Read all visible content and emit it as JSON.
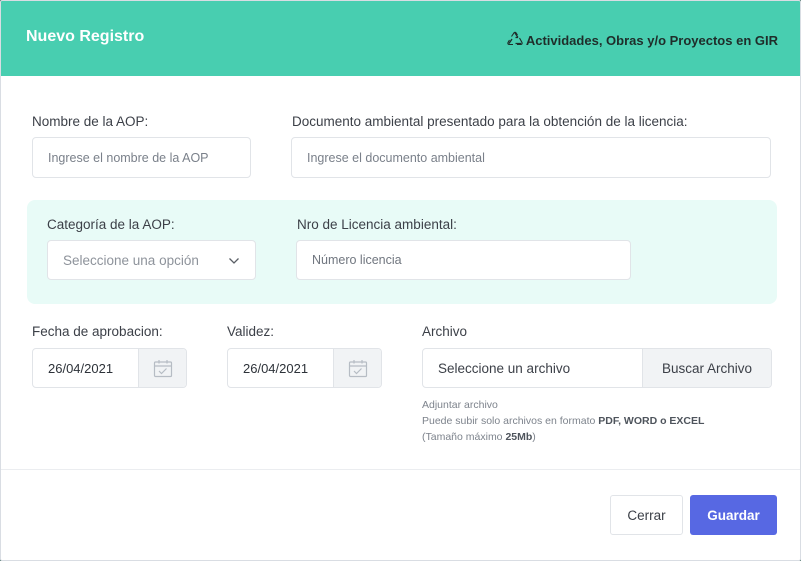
{
  "header": {
    "title": "Nuevo Registro",
    "context": "Actividades, Obras y/o Proyectos en GIR",
    "context_icon": "recycle-icon"
  },
  "form": {
    "nombre_label": "Nombre de la AOP:",
    "nombre_placeholder": "Ingrese el nombre de la AOP",
    "documento_label": "Documento ambiental presentado para la obtención de la licencia:",
    "documento_placeholder": "Ingrese el documento ambiental",
    "categoria_label": "Categoría de la AOP:",
    "categoria_selected": "Seleccione una opción",
    "licencia_label": "Nro de Licencia ambiental:",
    "licencia_placeholder": "Número licencia",
    "fecha_label": "Fecha de aprobacion:",
    "fecha_value": "26/04/2021",
    "validez_label": "Validez:",
    "validez_value": "26/04/2021",
    "archivo_label": "Archivo",
    "archivo_value": "Seleccione un archivo",
    "archivo_button": "Buscar Archivo",
    "help_line1": "Adjuntar archivo",
    "help_line2_prefix": "Puede subir solo archivos en formato ",
    "help_line2_formats": "PDF, WORD o EXCEL",
    "help_line3_prefix": "(Tamaño máximo ",
    "help_line3_size": "25Mb",
    "help_line3_suffix": ")"
  },
  "footer": {
    "close_label": "Cerrar",
    "save_label": "Guardar"
  },
  "colors": {
    "header_bg": "#48ceb0",
    "section_bg": "#e8fbf7",
    "primary": "#5768e3"
  }
}
